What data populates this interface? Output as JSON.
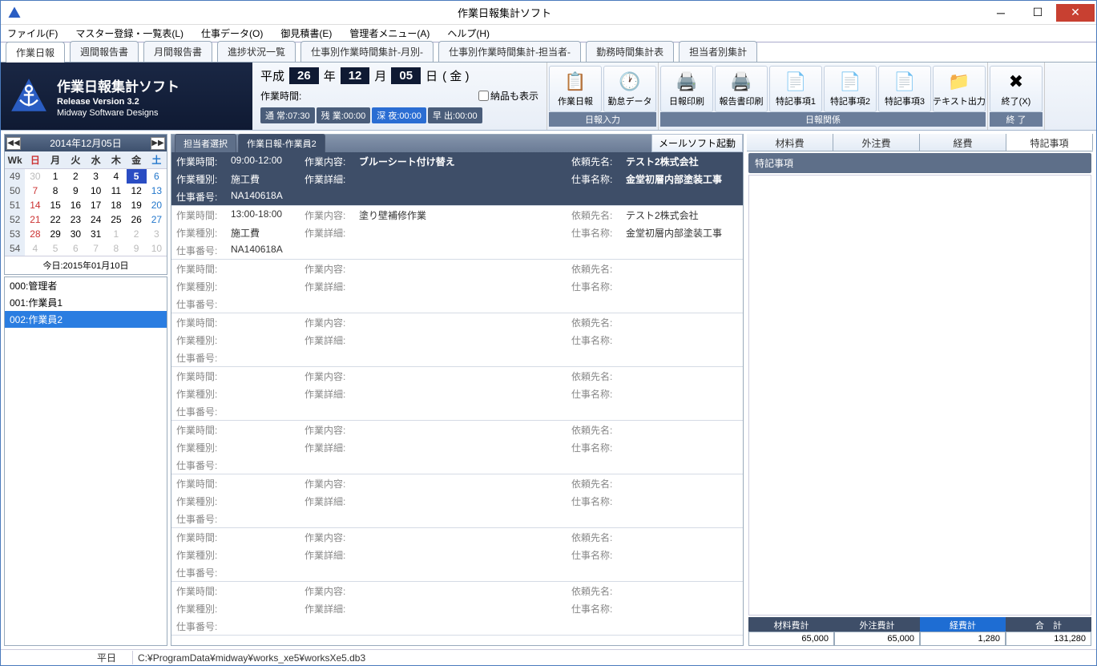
{
  "window": {
    "title": "作業日報集計ソフト"
  },
  "menu": [
    "ファイル(F)",
    "マスター登録・一覧表(L)",
    "仕事データ(O)",
    "御見積書(E)",
    "管理者メニュー(A)",
    "ヘルプ(H)"
  ],
  "maintabs": [
    "作業日報",
    "週間報告書",
    "月間報告書",
    "進捗状況一覧",
    "仕事別作業時間集計-月別-",
    "仕事別作業時間集計-担当者-",
    "勤務時間集計表",
    "担当者別集計"
  ],
  "brand": {
    "title": "作業日報集計ソフト",
    "version": "Release Version 3.2",
    "company": "Midway Software Designs"
  },
  "date": {
    "era": "平成",
    "y": "26",
    "ylabel": "年",
    "m": "12",
    "mlabel": "月",
    "d": "05",
    "dlabel": "日",
    "dow": "( 金 )"
  },
  "timelabel": "作業時間:",
  "delivery": "納品も表示",
  "chips": {
    "norm": "通 常:07:30",
    "ot": "残 業:00:00",
    "night": "深 夜:00:00",
    "early": "早 出:00:00"
  },
  "tg1": {
    "b1": "作業日報",
    "b2": "勤怠データ",
    "ftr": "日報入力"
  },
  "tg2": {
    "b1": "日報印刷",
    "b2": "報告書印刷",
    "b3": "特記事項1",
    "b4": "特記事項2",
    "b5": "特記事項3",
    "b6": "テキスト出力",
    "ftr": "日報関係"
  },
  "tg3": {
    "b1": "終了(X)",
    "ftr": "終 了"
  },
  "cal": {
    "title": "2014年12月05日",
    "wkh": "Wk",
    "days": [
      "日",
      "月",
      "火",
      "水",
      "木",
      "金",
      "土"
    ],
    "rows": [
      {
        "wk": "49",
        "d": [
          "30",
          "1",
          "2",
          "3",
          "4",
          "5",
          "6"
        ],
        "flags": [
          "g",
          "",
          "",
          "",
          "",
          "sel",
          "sat"
        ]
      },
      {
        "wk": "50",
        "d": [
          "7",
          "8",
          "9",
          "10",
          "11",
          "12",
          "13"
        ],
        "flags": [
          "sun",
          "",
          "",
          "",
          "",
          "",
          "sat"
        ]
      },
      {
        "wk": "51",
        "d": [
          "14",
          "15",
          "16",
          "17",
          "18",
          "19",
          "20"
        ],
        "flags": [
          "sun",
          "",
          "",
          "",
          "",
          "",
          "sat"
        ]
      },
      {
        "wk": "52",
        "d": [
          "21",
          "22",
          "23",
          "24",
          "25",
          "26",
          "27"
        ],
        "flags": [
          "sun",
          "",
          "",
          "",
          "",
          "",
          "sat"
        ]
      },
      {
        "wk": "53",
        "d": [
          "28",
          "29",
          "30",
          "31",
          "1",
          "2",
          "3"
        ],
        "flags": [
          "sun",
          "",
          "",
          "",
          "g",
          "g",
          "g"
        ]
      },
      {
        "wk": "54",
        "d": [
          "4",
          "5",
          "6",
          "7",
          "8",
          "9",
          "10"
        ],
        "flags": [
          "g",
          "g",
          "g",
          "g",
          "g",
          "g",
          "g"
        ]
      }
    ],
    "today": "今日:2015年01月10日"
  },
  "staff": [
    {
      "id": "000:管理者",
      "sel": false
    },
    {
      "id": "001:作業員1",
      "sel": false
    },
    {
      "id": "002:作業員2",
      "sel": true
    }
  ],
  "midtabs": {
    "t1": "担当者選択",
    "t2": "作業日報-作業員2",
    "mail": "メールソフト起動"
  },
  "labels": {
    "time": "作業時間:",
    "kind": "作業種別:",
    "jobno": "仕事番号:",
    "content": "作業内容:",
    "detail": "作業詳細:",
    "client": "依頼先名:",
    "jobname": "仕事名称:"
  },
  "entries": [
    {
      "sel": true,
      "time": "09:00-12:00",
      "kind": "施工費",
      "jobno": "NA140618A",
      "content": "ブルーシート付け替え",
      "detail": "",
      "client": "テスト2株式会社",
      "jobname": "金堂初層内部塗装工事"
    },
    {
      "sel": false,
      "time": "13:00-18:00",
      "kind": "施工費",
      "jobno": "NA140618A",
      "content": "塗り壁補修作業",
      "detail": "",
      "client": "テスト2株式会社",
      "jobname": "金堂初層内部塗装工事"
    },
    {
      "sel": false,
      "time": "",
      "kind": "",
      "jobno": "",
      "content": "",
      "detail": "",
      "client": "",
      "jobname": ""
    },
    {
      "sel": false,
      "time": "",
      "kind": "",
      "jobno": "",
      "content": "",
      "detail": "",
      "client": "",
      "jobname": ""
    },
    {
      "sel": false,
      "time": "",
      "kind": "",
      "jobno": "",
      "content": "",
      "detail": "",
      "client": "",
      "jobname": ""
    },
    {
      "sel": false,
      "time": "",
      "kind": "",
      "jobno": "",
      "content": "",
      "detail": "",
      "client": "",
      "jobname": ""
    },
    {
      "sel": false,
      "time": "",
      "kind": "",
      "jobno": "",
      "content": "",
      "detail": "",
      "client": "",
      "jobname": ""
    },
    {
      "sel": false,
      "time": "",
      "kind": "",
      "jobno": "",
      "content": "",
      "detail": "",
      "client": "",
      "jobname": ""
    },
    {
      "sel": false,
      "time": "",
      "kind": "",
      "jobno": "",
      "content": "",
      "detail": "",
      "client": "",
      "jobname": ""
    }
  ],
  "rtabs": [
    "材料費",
    "外注費",
    "経費",
    "特記事項"
  ],
  "note_hdr": "特記事項",
  "totals": {
    "h": [
      "材料費計",
      "外注費計",
      "経費計",
      "合　計"
    ],
    "v": [
      "65,000",
      "65,000",
      "1,280",
      "131,280"
    ]
  },
  "status": {
    "daytype": "平日",
    "path": "C:¥ProgramData¥midway¥works_xe5¥worksXe5.db3"
  }
}
